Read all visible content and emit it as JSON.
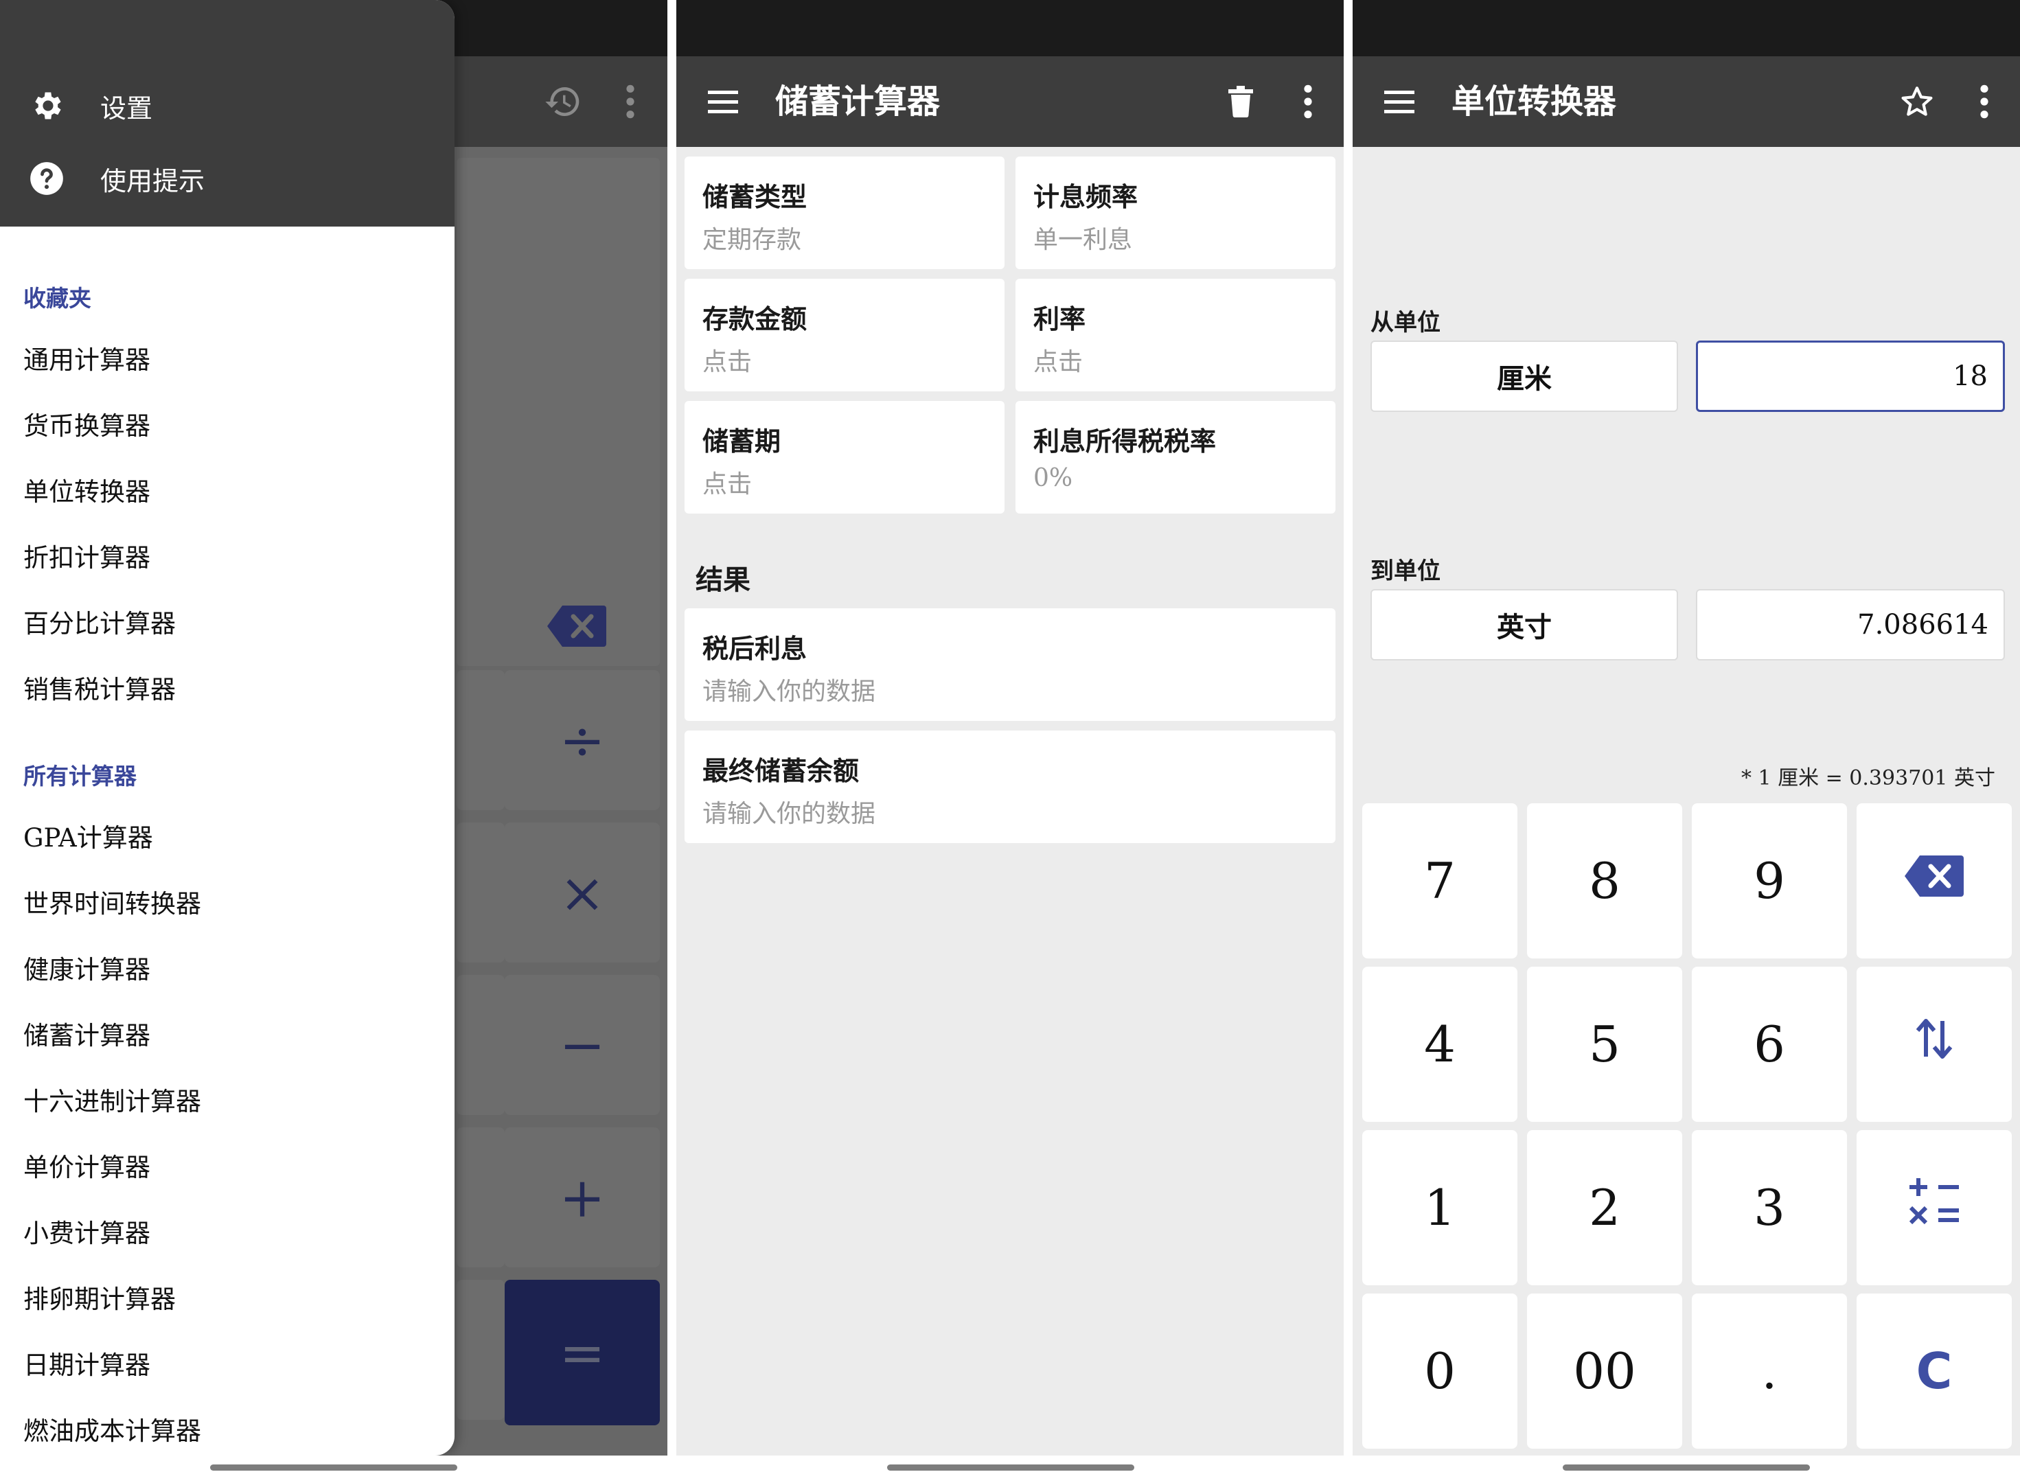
{
  "colors": {
    "accent": "#3f4fa3",
    "appbar": "#3d3d3d",
    "statusbar": "#1b1b1b",
    "background": "#ececec"
  },
  "panel1": {
    "background_calculator": {
      "icons": [
        "history-icon",
        "more-vert-icon",
        "backspace-icon"
      ],
      "operators": [
        "÷",
        "×",
        "−",
        "+",
        "="
      ]
    },
    "drawer": {
      "header_items": [
        {
          "label": "设置",
          "icon": "gear-icon"
        },
        {
          "label": "使用提示",
          "icon": "help-circle-icon"
        }
      ],
      "favorites_title": "收藏夹",
      "favorites": [
        "通用计算器",
        "货币换算器",
        "单位转换器",
        "折扣计算器",
        "百分比计算器",
        "销售税计算器"
      ],
      "all_title": "所有计算器",
      "all": [
        "GPA计算器",
        "世界时间转换器",
        "健康计算器",
        "储蓄计算器",
        "十六进制计算器",
        "单价计算器",
        "小费计算器",
        "排卵期计算器",
        "日期计算器",
        "燃油成本计算器"
      ]
    }
  },
  "panel2": {
    "title": "储蓄计算器",
    "fields": [
      {
        "label": "储蓄类型",
        "value": "定期存款"
      },
      {
        "label": "计息频率",
        "value": "单一利息"
      },
      {
        "label": "存款金额",
        "value": "点击"
      },
      {
        "label": "利率",
        "value": "点击"
      },
      {
        "label": "储蓄期",
        "value": "点击"
      },
      {
        "label": "利息所得税税率",
        "value": "0%"
      }
    ],
    "results_title": "结果",
    "results": [
      {
        "label": "税后利息",
        "value": "请输入你的数据"
      },
      {
        "label": "最终储蓄余额",
        "value": "请输入你的数据"
      }
    ]
  },
  "panel3": {
    "title": "单位转换器",
    "from_label": "从单位",
    "from_unit": "厘米",
    "from_value": "18",
    "to_label": "到单位",
    "to_unit": "英寸",
    "to_value": "7.086614",
    "note": "* 1 厘米 = 0.393701 英寸",
    "keys": [
      "7",
      "8",
      "9",
      "4",
      "5",
      "6",
      "1",
      "2",
      "3",
      "0",
      "00",
      "."
    ],
    "function_keys": [
      "backspace-icon",
      "swap-icon",
      "calculator-icon",
      "C"
    ]
  }
}
